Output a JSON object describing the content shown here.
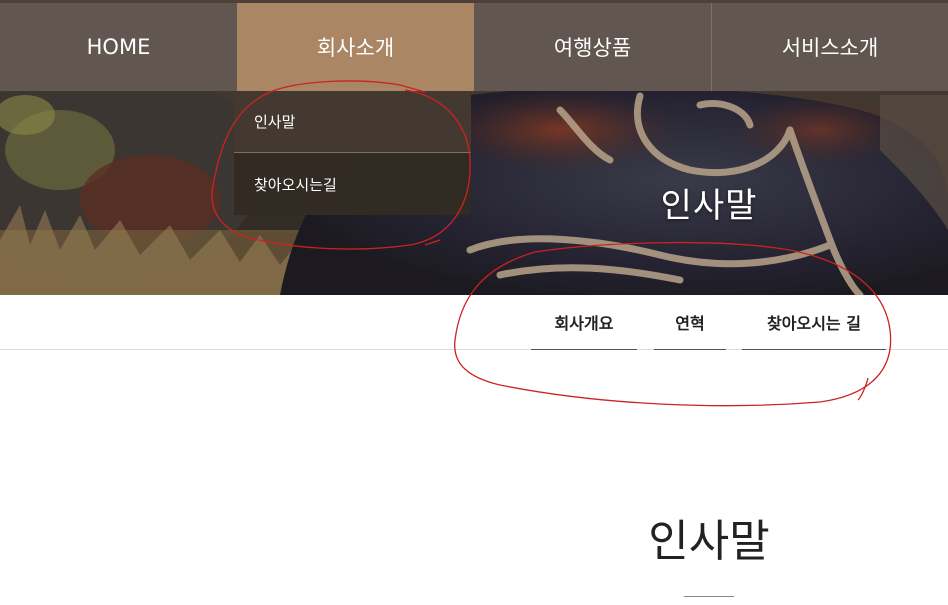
{
  "topnav": {
    "items": [
      {
        "label": "HOME"
      },
      {
        "label": "회사소개"
      },
      {
        "label": "여행상품"
      },
      {
        "label": "서비스소개"
      }
    ]
  },
  "dropdown": {
    "items": [
      {
        "label": "인사말"
      },
      {
        "label": "찾아오시는길"
      }
    ]
  },
  "hero": {
    "title": "인사말"
  },
  "subnav": {
    "tabs": [
      {
        "label": "회사개요"
      },
      {
        "label": "연혁"
      },
      {
        "label": "찾아오시는 길"
      }
    ]
  },
  "main": {
    "title": "인사말"
  },
  "colors": {
    "nav_bg": "#625750",
    "nav_active": "#aa8664",
    "dropdown_bg": "#443a31",
    "annotation": "#cc2222"
  }
}
